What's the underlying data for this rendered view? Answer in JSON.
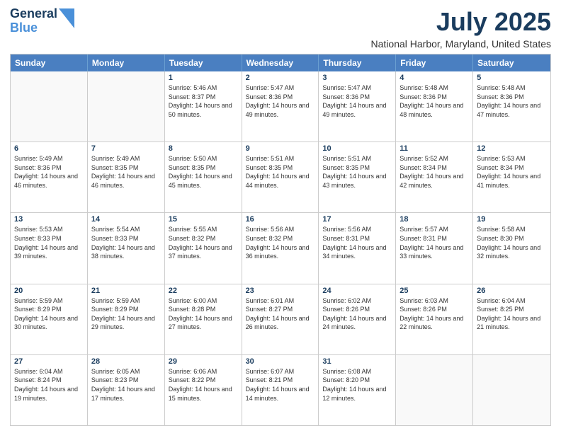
{
  "header": {
    "logo_line1": "General",
    "logo_line2": "Blue",
    "main_title": "July 2025",
    "subtitle": "National Harbor, Maryland, United States"
  },
  "days_of_week": [
    "Sunday",
    "Monday",
    "Tuesday",
    "Wednesday",
    "Thursday",
    "Friday",
    "Saturday"
  ],
  "weeks": [
    [
      {
        "day": "",
        "sunrise": "",
        "sunset": "",
        "daylight": ""
      },
      {
        "day": "",
        "sunrise": "",
        "sunset": "",
        "daylight": ""
      },
      {
        "day": "1",
        "sunrise": "Sunrise: 5:46 AM",
        "sunset": "Sunset: 8:37 PM",
        "daylight": "Daylight: 14 hours and 50 minutes."
      },
      {
        "day": "2",
        "sunrise": "Sunrise: 5:47 AM",
        "sunset": "Sunset: 8:36 PM",
        "daylight": "Daylight: 14 hours and 49 minutes."
      },
      {
        "day": "3",
        "sunrise": "Sunrise: 5:47 AM",
        "sunset": "Sunset: 8:36 PM",
        "daylight": "Daylight: 14 hours and 49 minutes."
      },
      {
        "day": "4",
        "sunrise": "Sunrise: 5:48 AM",
        "sunset": "Sunset: 8:36 PM",
        "daylight": "Daylight: 14 hours and 48 minutes."
      },
      {
        "day": "5",
        "sunrise": "Sunrise: 5:48 AM",
        "sunset": "Sunset: 8:36 PM",
        "daylight": "Daylight: 14 hours and 47 minutes."
      }
    ],
    [
      {
        "day": "6",
        "sunrise": "Sunrise: 5:49 AM",
        "sunset": "Sunset: 8:36 PM",
        "daylight": "Daylight: 14 hours and 46 minutes."
      },
      {
        "day": "7",
        "sunrise": "Sunrise: 5:49 AM",
        "sunset": "Sunset: 8:35 PM",
        "daylight": "Daylight: 14 hours and 46 minutes."
      },
      {
        "day": "8",
        "sunrise": "Sunrise: 5:50 AM",
        "sunset": "Sunset: 8:35 PM",
        "daylight": "Daylight: 14 hours and 45 minutes."
      },
      {
        "day": "9",
        "sunrise": "Sunrise: 5:51 AM",
        "sunset": "Sunset: 8:35 PM",
        "daylight": "Daylight: 14 hours and 44 minutes."
      },
      {
        "day": "10",
        "sunrise": "Sunrise: 5:51 AM",
        "sunset": "Sunset: 8:35 PM",
        "daylight": "Daylight: 14 hours and 43 minutes."
      },
      {
        "day": "11",
        "sunrise": "Sunrise: 5:52 AM",
        "sunset": "Sunset: 8:34 PM",
        "daylight": "Daylight: 14 hours and 42 minutes."
      },
      {
        "day": "12",
        "sunrise": "Sunrise: 5:53 AM",
        "sunset": "Sunset: 8:34 PM",
        "daylight": "Daylight: 14 hours and 41 minutes."
      }
    ],
    [
      {
        "day": "13",
        "sunrise": "Sunrise: 5:53 AM",
        "sunset": "Sunset: 8:33 PM",
        "daylight": "Daylight: 14 hours and 39 minutes."
      },
      {
        "day": "14",
        "sunrise": "Sunrise: 5:54 AM",
        "sunset": "Sunset: 8:33 PM",
        "daylight": "Daylight: 14 hours and 38 minutes."
      },
      {
        "day": "15",
        "sunrise": "Sunrise: 5:55 AM",
        "sunset": "Sunset: 8:32 PM",
        "daylight": "Daylight: 14 hours and 37 minutes."
      },
      {
        "day": "16",
        "sunrise": "Sunrise: 5:56 AM",
        "sunset": "Sunset: 8:32 PM",
        "daylight": "Daylight: 14 hours and 36 minutes."
      },
      {
        "day": "17",
        "sunrise": "Sunrise: 5:56 AM",
        "sunset": "Sunset: 8:31 PM",
        "daylight": "Daylight: 14 hours and 34 minutes."
      },
      {
        "day": "18",
        "sunrise": "Sunrise: 5:57 AM",
        "sunset": "Sunset: 8:31 PM",
        "daylight": "Daylight: 14 hours and 33 minutes."
      },
      {
        "day": "19",
        "sunrise": "Sunrise: 5:58 AM",
        "sunset": "Sunset: 8:30 PM",
        "daylight": "Daylight: 14 hours and 32 minutes."
      }
    ],
    [
      {
        "day": "20",
        "sunrise": "Sunrise: 5:59 AM",
        "sunset": "Sunset: 8:29 PM",
        "daylight": "Daylight: 14 hours and 30 minutes."
      },
      {
        "day": "21",
        "sunrise": "Sunrise: 5:59 AM",
        "sunset": "Sunset: 8:29 PM",
        "daylight": "Daylight: 14 hours and 29 minutes."
      },
      {
        "day": "22",
        "sunrise": "Sunrise: 6:00 AM",
        "sunset": "Sunset: 8:28 PM",
        "daylight": "Daylight: 14 hours and 27 minutes."
      },
      {
        "day": "23",
        "sunrise": "Sunrise: 6:01 AM",
        "sunset": "Sunset: 8:27 PM",
        "daylight": "Daylight: 14 hours and 26 minutes."
      },
      {
        "day": "24",
        "sunrise": "Sunrise: 6:02 AM",
        "sunset": "Sunset: 8:26 PM",
        "daylight": "Daylight: 14 hours and 24 minutes."
      },
      {
        "day": "25",
        "sunrise": "Sunrise: 6:03 AM",
        "sunset": "Sunset: 8:26 PM",
        "daylight": "Daylight: 14 hours and 22 minutes."
      },
      {
        "day": "26",
        "sunrise": "Sunrise: 6:04 AM",
        "sunset": "Sunset: 8:25 PM",
        "daylight": "Daylight: 14 hours and 21 minutes."
      }
    ],
    [
      {
        "day": "27",
        "sunrise": "Sunrise: 6:04 AM",
        "sunset": "Sunset: 8:24 PM",
        "daylight": "Daylight: 14 hours and 19 minutes."
      },
      {
        "day": "28",
        "sunrise": "Sunrise: 6:05 AM",
        "sunset": "Sunset: 8:23 PM",
        "daylight": "Daylight: 14 hours and 17 minutes."
      },
      {
        "day": "29",
        "sunrise": "Sunrise: 6:06 AM",
        "sunset": "Sunset: 8:22 PM",
        "daylight": "Daylight: 14 hours and 15 minutes."
      },
      {
        "day": "30",
        "sunrise": "Sunrise: 6:07 AM",
        "sunset": "Sunset: 8:21 PM",
        "daylight": "Daylight: 14 hours and 14 minutes."
      },
      {
        "day": "31",
        "sunrise": "Sunrise: 6:08 AM",
        "sunset": "Sunset: 8:20 PM",
        "daylight": "Daylight: 14 hours and 12 minutes."
      },
      {
        "day": "",
        "sunrise": "",
        "sunset": "",
        "daylight": ""
      },
      {
        "day": "",
        "sunrise": "",
        "sunset": "",
        "daylight": ""
      }
    ]
  ]
}
